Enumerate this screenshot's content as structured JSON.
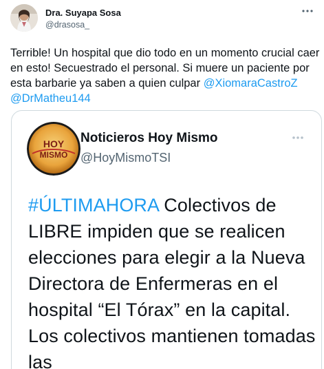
{
  "tweet": {
    "author": {
      "name": "Dra. Suyapa Sosa",
      "handle": "@drasosa_"
    },
    "text_prefix": "Terrible! Un hospital que dio todo en un momento crucial caer en esto! Secuestrado el personal. Si muere un paciente por esta barbarie ya saben a quien culpar",
    "mentions": [
      "@XiomaraCastroZ",
      "@DrMatheu144"
    ],
    "more_icon": "more-horizontal-icon",
    "colors": {
      "link": "#1d9bf0",
      "secondary_text": "#536471",
      "border": "#cfd9de"
    }
  },
  "quoted": {
    "author": {
      "name": "Noticieros Hoy Mismo",
      "handle": "@HoyMismoTSI",
      "logo_text_line1": "HOY",
      "logo_text_line2": "MISMO"
    },
    "hashtag": "#ÚLTIMAHORA",
    "text": "Colectivos de LIBRE impiden que se realicen elecciones para elegir a la Nueva Directora de Enfermeras en el hospital “El Tórax” en la capital. Los colectivos mantienen tomadas las",
    "more_icon": "more-horizontal-icon"
  }
}
